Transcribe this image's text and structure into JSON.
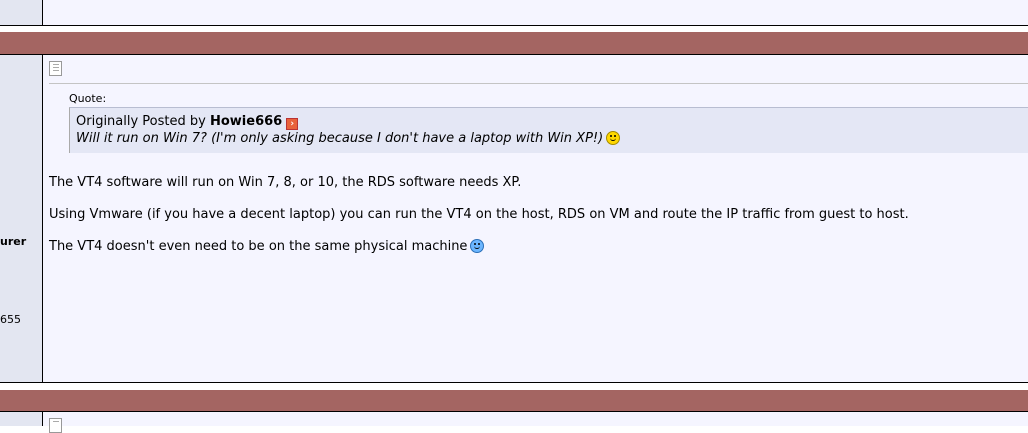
{
  "post": {
    "user_title_fragment": "urer",
    "posts_count_fragment": "655",
    "quote": {
      "label": "Quote:",
      "prefix": "Originally Posted by",
      "author": "Howie666",
      "text": "Will it run on Win 7? (I'm only asking because I don't have a laptop with Win XP!)"
    },
    "message": [
      "The VT4 software will run on Win 7, 8, or 10, the RDS software needs XP.",
      "Using Vmware (if you have a decent laptop) you can run the VT4 on the host, RDS on VM and route the IP traffic from guest to host.",
      "The VT4 doesn't even need to be on the same physical machine"
    ]
  },
  "icons": {
    "post_icon": "post-document-icon",
    "view_post": "view-post-arrow-icon",
    "smile": "smile-emoticon-icon",
    "wink": "smile-blue-emoticon-icon"
  },
  "colors": {
    "thead_bar": "#a46562",
    "sidebar": "#e3e6f1",
    "post_bg": "#f5f5ff",
    "quote_bg": "#e4e7f5"
  }
}
